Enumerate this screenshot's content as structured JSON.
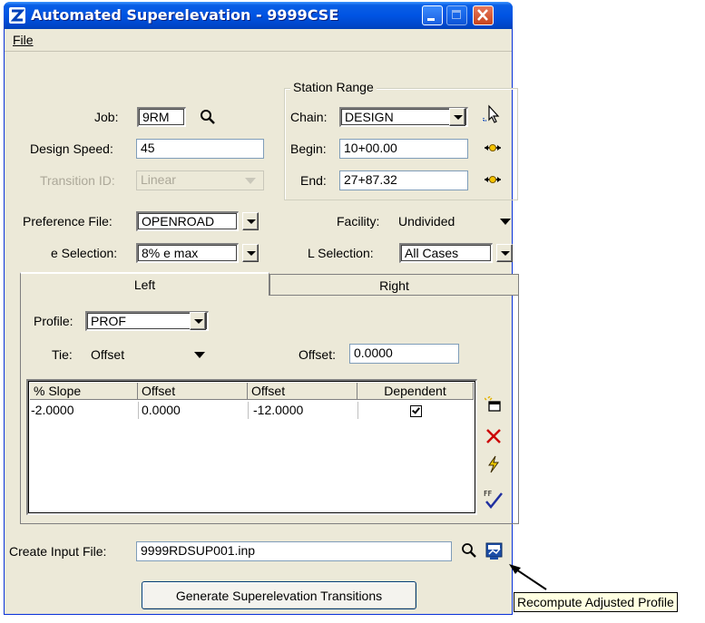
{
  "window": {
    "title": "Automated Superelevation - 9999CSE"
  },
  "menu": {
    "file": "File"
  },
  "job": {
    "label": "Job:",
    "value": "9RM"
  },
  "design_speed": {
    "label": "Design Speed:",
    "value": "45"
  },
  "transition": {
    "label": "Transition ID:",
    "value": "Linear"
  },
  "station_range": {
    "legend": "Station Range",
    "chain_label": "Chain:",
    "chain_value": "DESIGN",
    "begin_label": "Begin:",
    "begin_value": "10+00.00",
    "end_label": "End:",
    "end_value": "27+87.32"
  },
  "preference": {
    "label": "Preference File:",
    "value": "OPENROAD"
  },
  "facility": {
    "label": "Facility:",
    "value": "Undivided"
  },
  "e_selection": {
    "label": "e Selection:",
    "value": "8% e max"
  },
  "l_selection": {
    "label": "L Selection:",
    "value": "All Cases"
  },
  "tabs": {
    "left": "Left",
    "right": "Right"
  },
  "profile": {
    "label": "Profile:",
    "value": "PROF"
  },
  "tie": {
    "label": "Tie:",
    "value": "Offset"
  },
  "offset": {
    "label": "Offset:",
    "value": "0.0000"
  },
  "table": {
    "headers": [
      "% Slope",
      "Offset",
      "Offset",
      "Dependent"
    ],
    "rows": [
      {
        "slope": "-2.0000",
        "offset1": "0.0000",
        "offset2": "-12.0000",
        "dependent": true
      }
    ]
  },
  "create_input": {
    "label": "Create Input File:",
    "value": "9999RDSUP001.inp"
  },
  "generate_button": "Generate Superelevation Transitions",
  "tooltip": "Recompute Adjusted Profile",
  "colors": {
    "title_bar": "#0054e3",
    "dialog_bg": "#ece9d8",
    "tooltip_bg": "#ffffe1",
    "delete_icon": "#cc0000"
  }
}
